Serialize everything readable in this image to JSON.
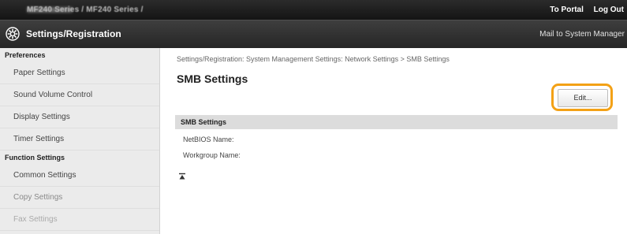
{
  "topbar": {
    "device_name": "MF240 Series / MF240 Series /",
    "portal_link": "To Portal",
    "logout_link": "Log Out"
  },
  "titlebar": {
    "title": "Settings/Registration",
    "mail_link": "Mail to System Manager"
  },
  "sidebar": {
    "preferences_heading": "Preferences",
    "preferences_items": [
      {
        "label": "Paper Settings"
      },
      {
        "label": "Sound Volume Control"
      },
      {
        "label": "Display Settings"
      },
      {
        "label": "Timer Settings"
      }
    ],
    "function_heading": "Function Settings",
    "function_items": [
      {
        "label": "Common Settings"
      },
      {
        "label": "Copy Settings"
      },
      {
        "label": "Fax Settings"
      }
    ]
  },
  "main": {
    "breadcrumb": "Settings/Registration: System Management Settings: Network Settings > SMB Settings",
    "page_title": "SMB Settings",
    "edit_button": "Edit...",
    "section_title": "SMB Settings",
    "fields": [
      {
        "label": "NetBIOS Name:"
      },
      {
        "label": "Workgroup Name:"
      }
    ]
  },
  "colors": {
    "highlight": "#f3a116",
    "topbar": "#1c1c1c",
    "sidebar_bg": "#ebebeb",
    "section_bar": "#dcdcdc"
  },
  "icons": [
    "settings-gear-icon",
    "back-to-top-icon"
  ]
}
